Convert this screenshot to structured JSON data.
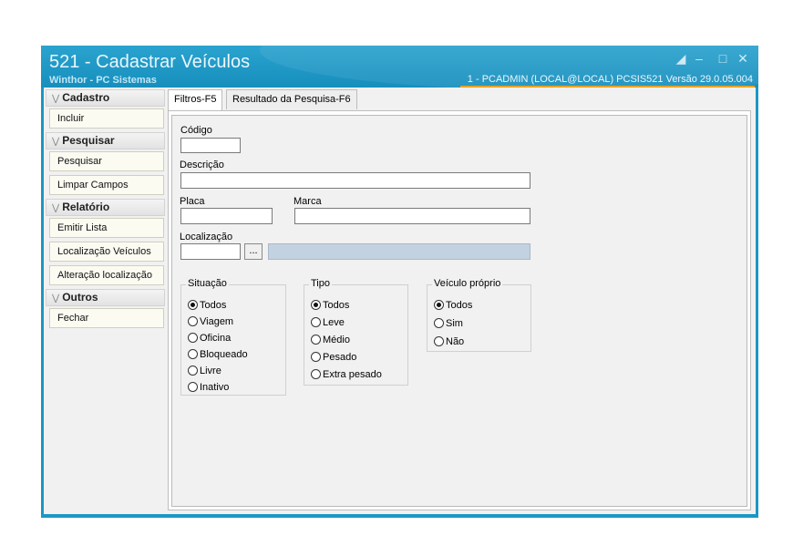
{
  "window": {
    "title": "521 - Cadastrar Veículos",
    "subtitle": "Winthor - PC Sistemas",
    "status_info": "1 - PCADMIN (LOCAL@LOCAL)   PCSIS521  Versão  29.0.05.004",
    "controls": [
      "restore-icon",
      "minimize-icon",
      "maximize-icon",
      "close-icon"
    ]
  },
  "sidebar": {
    "sections": [
      {
        "title": "Cadastro",
        "items": [
          "Incluir"
        ]
      },
      {
        "title": "Pesquisar",
        "items": [
          "Pesquisar",
          "Limpar Campos"
        ]
      },
      {
        "title": "Relatório",
        "items": [
          "Emitir Lista",
          "Localização Veículos",
          "Alteração localização"
        ]
      },
      {
        "title": "Outros",
        "items": [
          "Fechar"
        ]
      }
    ]
  },
  "tabs": [
    {
      "label": "Filtros-F5",
      "active": true
    },
    {
      "label": "Resultado da Pesquisa-F6",
      "active": false
    }
  ],
  "form": {
    "codigo_label": "Código",
    "codigo_value": "",
    "descricao_label": "Descrição",
    "descricao_value": "",
    "placa_label": "Placa",
    "placa_value": "",
    "marca_label": "Marca",
    "marca_value": "",
    "localizacao_label": "Localização",
    "localizacao_value": "",
    "localizacao_button": "...",
    "localizacao_desc": ""
  },
  "groups": {
    "situacao": {
      "title": "Situação",
      "options": [
        "Todos",
        "Viagem",
        "Oficina",
        "Bloqueado",
        "Livre",
        "Inativo"
      ],
      "selected": "Todos"
    },
    "tipo": {
      "title": "Tipo",
      "options": [
        "Todos",
        "Leve",
        "Médio",
        "Pesado",
        "Extra pesado"
      ],
      "selected": "Todos"
    },
    "veiculo_proprio": {
      "title": "Veículo próprio",
      "options": [
        "Todos",
        "Sim",
        "Não"
      ],
      "selected": "Todos"
    }
  }
}
